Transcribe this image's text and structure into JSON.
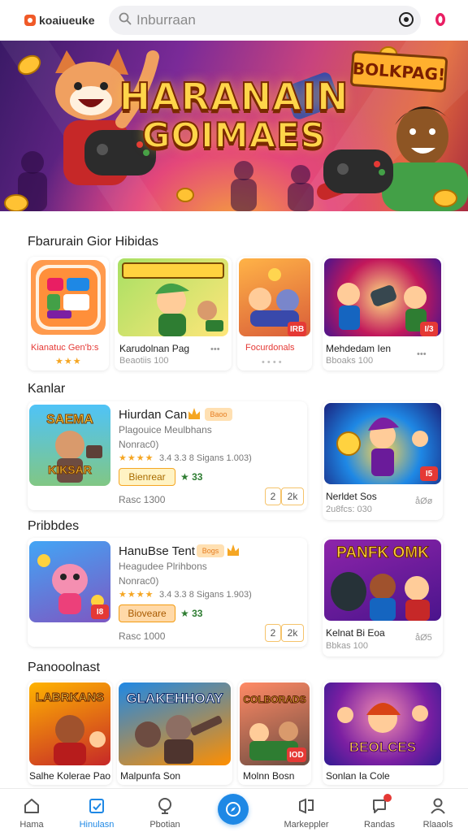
{
  "header": {
    "brand": "koaiueuke",
    "search_placeholder": "Inburraan"
  },
  "banner": {
    "title_line1": "HARANAIN",
    "title_line2": "GOIMAES",
    "tag": "BOLKPAG!"
  },
  "sections": [
    {
      "title": "Fbarurain Gior Hibidas",
      "items": [
        {
          "caption": "Kianatuc Gen'b:s",
          "sub": "",
          "badge": ""
        },
        {
          "caption": "Karudolnan Pag",
          "sub": "Beaotiis 100",
          "badge": ""
        },
        {
          "caption": "Focurdonals",
          "sub": "",
          "badge": "IRB"
        },
        {
          "caption": "Mehdedam Ien",
          "sub": "Bboaks  100",
          "badge": "I/3"
        }
      ]
    },
    {
      "title": "Kanlar",
      "feature": {
        "thumb_text": "SAEMA",
        "thumb_text2": "KIKSAR",
        "title": "Hiurdan Can",
        "tag": "Baoo",
        "line1": "Plagouice Meulbhans",
        "line2": "Nonrac0)",
        "rating": "3.4  3.3 8  Sigans  1.003)",
        "button": "Bienrear",
        "bonus": "★ 33",
        "price": "Rasc 1300",
        "qty": "2",
        "qty_unit": "2k"
      },
      "side": {
        "caption": "Nerldet Sos",
        "sub": "2u8fcs:  030",
        "sub_right": "åØø",
        "badge": "I5"
      }
    },
    {
      "title": "Pribbdes",
      "feature": {
        "thumb_text": "",
        "badge": "I8",
        "title": "HanuBse Tent",
        "tag": "Bogs",
        "line1": "Heagudee Plrihbons",
        "line2": "Nonrac0)",
        "rating": "3.4  3.3 8  Sigans  1.903)",
        "button": "Bioveare",
        "bonus": "★ 33",
        "price": "Rasc 1000",
        "qty": "2",
        "qty_unit": "2k"
      },
      "side": {
        "caption": "Kelnat Bi Eoa",
        "sub": "Bbkas  100",
        "sub_right": "åØ5",
        "thumb_text": "PANFK OMK"
      }
    },
    {
      "title": "Panooolnast",
      "items": [
        {
          "caption": "Salhe Kolerae Pao",
          "thumb_text": "LABRKANS"
        },
        {
          "caption": "Malpunfa Son",
          "thumb_text": "GLAKEHHOAY"
        },
        {
          "caption": "Molnn Bosn",
          "thumb_text": "COLBORADS",
          "badge": "IOD"
        },
        {
          "caption": "Sonlan Ia Cole",
          "thumb_text": "BEOLCES"
        }
      ]
    }
  ],
  "nav": {
    "items": [
      {
        "label": "Hama"
      },
      {
        "label": "Hinulasn"
      },
      {
        "label": "Pbotian"
      },
      {
        "label": "Markeppler"
      },
      {
        "label": "Randas"
      },
      {
        "label": "Rlaaols"
      }
    ]
  },
  "colors": {
    "accent": "#1e88e5",
    "badge": "#e53935",
    "star": "#f5a623",
    "brand": "#f05a28"
  }
}
